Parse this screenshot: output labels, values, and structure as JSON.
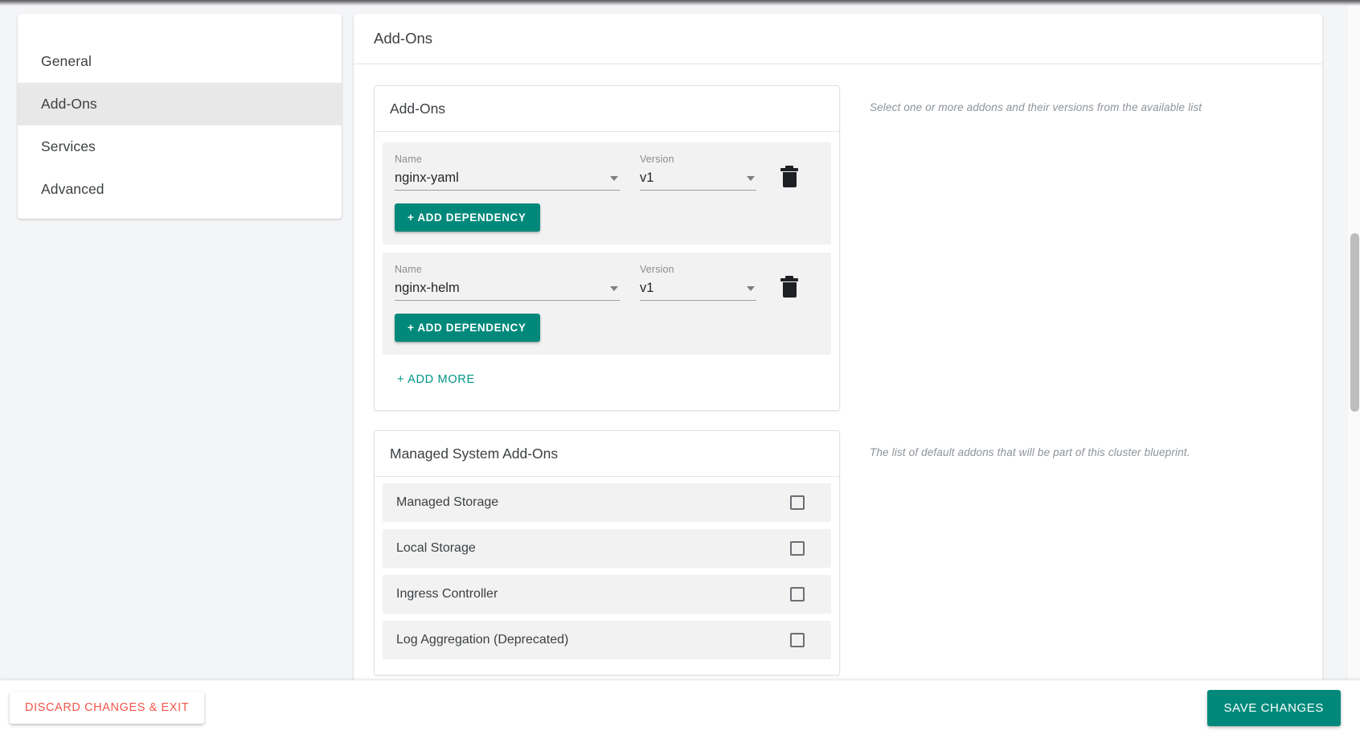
{
  "sidebar": {
    "items": [
      {
        "label": "General",
        "active": false
      },
      {
        "label": "Add-Ons",
        "active": true
      },
      {
        "label": "Services",
        "active": false
      },
      {
        "label": "Advanced",
        "active": false
      }
    ]
  },
  "header": {
    "title": "Add-Ons"
  },
  "addons_section": {
    "title": "Add-Ons",
    "help": "Select one or more addons and their versions from the available list",
    "name_label": "Name",
    "version_label": "Version",
    "add_dependency_label": "+ ADD DEPENDENCY",
    "add_more_label": "+ ADD MORE",
    "delete_icon": "trash-icon",
    "caret_icon": "chevron-down-icon",
    "rows": [
      {
        "name": "nginx-yaml",
        "version": "v1"
      },
      {
        "name": "nginx-helm",
        "version": "v1"
      }
    ]
  },
  "managed_section": {
    "title": "Managed System Add-Ons",
    "help": "The list of default addons that will be part of this cluster blueprint.",
    "rows": [
      {
        "label": "Managed Storage",
        "checked": false
      },
      {
        "label": "Local Storage",
        "checked": false
      },
      {
        "label": "Ingress Controller",
        "checked": false
      },
      {
        "label": "Log Aggregation (Deprecated)",
        "checked": false
      }
    ]
  },
  "footer": {
    "discard_label": "DISCARD CHANGES & EXIT",
    "save_label": "SAVE CHANGES"
  },
  "colors": {
    "accent_teal": "#00897b",
    "link_teal": "#009688",
    "danger_red": "#f4554a",
    "page_bg": "#f4f5f7",
    "row_bg": "#f2f2f2"
  }
}
